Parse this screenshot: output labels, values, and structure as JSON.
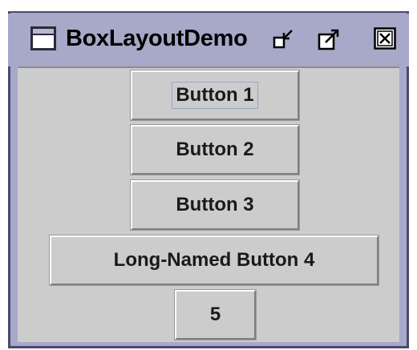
{
  "window": {
    "title": "BoxLayoutDemo"
  },
  "titlebar": {
    "icons": {
      "app": "window-icon",
      "minimize": "minimize-icon",
      "maximize": "maximize-icon",
      "close": "close-icon"
    }
  },
  "buttons": [
    {
      "label": "Button 1",
      "focused": true
    },
    {
      "label": "Button 2",
      "focused": false
    },
    {
      "label": "Button 3",
      "focused": false
    },
    {
      "label": "Long-Named Button 4",
      "focused": false
    },
    {
      "label": "5",
      "focused": false
    }
  ],
  "colors": {
    "titlebar": "#a8a8c8",
    "content": "#cccccc",
    "frame": "#4a4a6e"
  }
}
